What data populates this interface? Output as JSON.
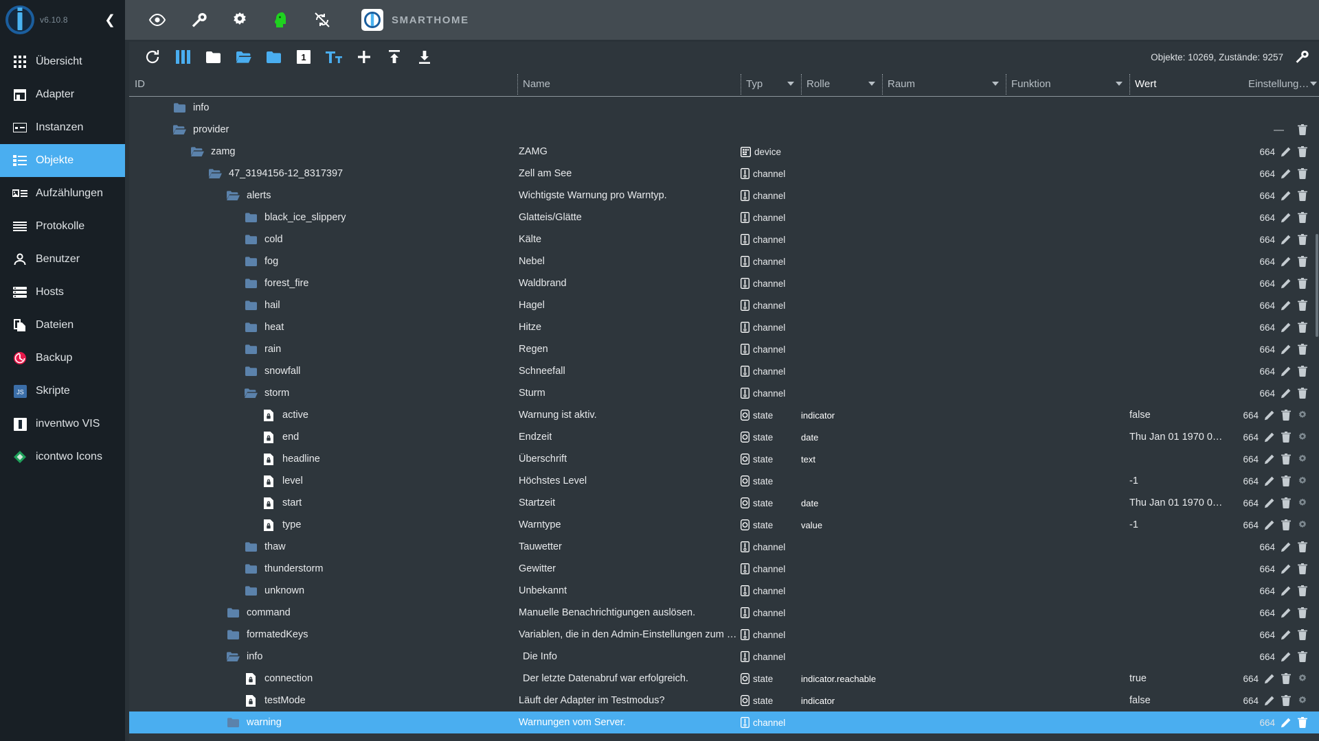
{
  "sidebar": {
    "version": "v6.10.8",
    "collapse_icon": "chevron-left-icon",
    "items": [
      {
        "label": "Übersicht",
        "icon": "grid-icon",
        "active": false
      },
      {
        "label": "Adapter",
        "icon": "shop-icon",
        "active": false
      },
      {
        "label": "Instanzen",
        "icon": "instances-icon",
        "active": false
      },
      {
        "label": "Objekte",
        "icon": "list-icon",
        "active": true
      },
      {
        "label": "Aufzählungen",
        "icon": "enums-icon",
        "active": false
      },
      {
        "label": "Protokolle",
        "icon": "lines-icon",
        "active": false
      },
      {
        "label": "Benutzer",
        "icon": "person-icon",
        "active": false
      },
      {
        "label": "Hosts",
        "icon": "hosts-icon",
        "active": false
      },
      {
        "label": "Dateien",
        "icon": "files-icon",
        "active": false
      },
      {
        "label": "Backup",
        "icon": "backup-clock-icon",
        "active": false
      },
      {
        "label": "Skripte",
        "icon": "js-icon",
        "active": false
      },
      {
        "label": "inventwo VIS",
        "icon": "inventwo-icon",
        "active": false
      },
      {
        "label": "icontwo Icons",
        "icon": "icontwo-icon",
        "active": false
      }
    ]
  },
  "topbar": {
    "icons": [
      "eye-icon",
      "wrench-icon",
      "gear-icon",
      "head-green-icon",
      "no-sync-icon"
    ],
    "host_label": "SMARTHOME",
    "host_logo_icon": "iobroker-logo-icon"
  },
  "objects_toolbar": {
    "buttons": [
      "refresh-icon",
      "columns-icon",
      "folder-closed-icon",
      "folder-open-icon",
      "folder-filled-icon",
      "expand-level-1-icon",
      "text-size-icon",
      "add-icon",
      "import-icon",
      "export-icon"
    ],
    "expand_level_label": "1",
    "stats": "Objekte: 10269, Zustände: 9257",
    "settings_icon": "wrench-icon"
  },
  "table": {
    "columns": [
      {
        "key": "id",
        "label": "ID",
        "sortable": false
      },
      {
        "key": "name",
        "label": "Name",
        "sortable": false
      },
      {
        "key": "typ",
        "label": "Typ",
        "sortable": true
      },
      {
        "key": "role",
        "label": "Rolle",
        "sortable": true
      },
      {
        "key": "room",
        "label": "Raum",
        "sortable": true
      },
      {
        "key": "func",
        "label": "Funktion",
        "sortable": true
      },
      {
        "key": "wert",
        "label": "Wert",
        "sortable": false
      },
      {
        "key": "set",
        "label": "Einstellung…",
        "sortable": true
      }
    ],
    "rows": [
      {
        "id": "info",
        "depth": 2,
        "icon": "folder-filled-icon",
        "name": "",
        "name_icon": "info-badge-icon",
        "typ": "",
        "typ_icon": "",
        "role": "",
        "wert": "",
        "perm": "",
        "actions": [],
        "selected": false,
        "partial": true
      },
      {
        "id": "provider",
        "depth": 2,
        "icon": "folder-open-icon",
        "name": "",
        "typ": "",
        "typ_icon": "",
        "role": "",
        "wert": "",
        "perm": "",
        "dash": true,
        "actions": [
          "delete-icon"
        ],
        "selected": false
      },
      {
        "id": "zamg",
        "depth": 3,
        "icon": "folder-open-icon",
        "name": "ZAMG",
        "typ": "device",
        "typ_icon": "device-icon",
        "role": "",
        "wert": "",
        "perm": "664",
        "actions": [
          "edit-icon",
          "delete-icon"
        ],
        "selected": false
      },
      {
        "id": "47_3194156-12_8317397",
        "depth": 4,
        "icon": "folder-open-icon",
        "name": "Zell am See",
        "typ": "channel",
        "typ_icon": "channel-icon",
        "role": "",
        "wert": "",
        "perm": "664",
        "actions": [
          "edit-icon",
          "delete-icon"
        ],
        "selected": false
      },
      {
        "id": "alerts",
        "depth": 5,
        "icon": "folder-open-icon",
        "name": "Wichtigste Warnung pro Warntyp.",
        "typ": "channel",
        "typ_icon": "channel-icon",
        "role": "",
        "wert": "",
        "perm": "664",
        "actions": [
          "edit-icon",
          "delete-icon"
        ],
        "selected": false
      },
      {
        "id": "black_ice_slippery",
        "depth": 6,
        "icon": "folder-filled-icon",
        "name": "Glatteis/Glätte",
        "typ": "channel",
        "typ_icon": "channel-icon",
        "role": "",
        "wert": "",
        "perm": "664",
        "actions": [
          "edit-icon",
          "delete-icon"
        ],
        "selected": false
      },
      {
        "id": "cold",
        "depth": 6,
        "icon": "folder-filled-icon",
        "name": "Kälte",
        "typ": "channel",
        "typ_icon": "channel-icon",
        "role": "",
        "wert": "",
        "perm": "664",
        "actions": [
          "edit-icon",
          "delete-icon"
        ],
        "selected": false
      },
      {
        "id": "fog",
        "depth": 6,
        "icon": "folder-filled-icon",
        "name": "Nebel",
        "typ": "channel",
        "typ_icon": "channel-icon",
        "role": "",
        "wert": "",
        "perm": "664",
        "actions": [
          "edit-icon",
          "delete-icon"
        ],
        "selected": false
      },
      {
        "id": "forest_fire",
        "depth": 6,
        "icon": "folder-filled-icon",
        "name": "Waldbrand",
        "typ": "channel",
        "typ_icon": "channel-icon",
        "role": "",
        "wert": "",
        "perm": "664",
        "actions": [
          "edit-icon",
          "delete-icon"
        ],
        "selected": false
      },
      {
        "id": "hail",
        "depth": 6,
        "icon": "folder-filled-icon",
        "name": "Hagel",
        "typ": "channel",
        "typ_icon": "channel-icon",
        "role": "",
        "wert": "",
        "perm": "664",
        "actions": [
          "edit-icon",
          "delete-icon"
        ],
        "selected": false
      },
      {
        "id": "heat",
        "depth": 6,
        "icon": "folder-filled-icon",
        "name": "Hitze",
        "typ": "channel",
        "typ_icon": "channel-icon",
        "role": "",
        "wert": "",
        "perm": "664",
        "actions": [
          "edit-icon",
          "delete-icon"
        ],
        "selected": false
      },
      {
        "id": "rain",
        "depth": 6,
        "icon": "folder-filled-icon",
        "name": "Regen",
        "typ": "channel",
        "typ_icon": "channel-icon",
        "role": "",
        "wert": "",
        "perm": "664",
        "actions": [
          "edit-icon",
          "delete-icon"
        ],
        "selected": false
      },
      {
        "id": "snowfall",
        "depth": 6,
        "icon": "folder-filled-icon",
        "name": "Schneefall",
        "typ": "channel",
        "typ_icon": "channel-icon",
        "role": "",
        "wert": "",
        "perm": "664",
        "actions": [
          "edit-icon",
          "delete-icon"
        ],
        "selected": false
      },
      {
        "id": "storm",
        "depth": 6,
        "icon": "folder-open-icon",
        "name": "Sturm",
        "typ": "channel",
        "typ_icon": "channel-icon",
        "role": "",
        "wert": "",
        "perm": "664",
        "actions": [
          "edit-icon",
          "delete-icon"
        ],
        "selected": false
      },
      {
        "id": "active",
        "depth": 7,
        "icon": "state-lock-icon",
        "name": "Warnung ist aktiv.",
        "typ": "state",
        "typ_icon": "state-icon",
        "role": "indicator",
        "wert": "false",
        "perm": "664",
        "actions": [
          "edit-icon",
          "delete-icon",
          "gear-icon"
        ],
        "selected": false
      },
      {
        "id": "end",
        "depth": 7,
        "icon": "state-lock-icon",
        "name": "Endzeit",
        "typ": "state",
        "typ_icon": "state-icon",
        "role": "date",
        "wert": "Thu Jan 01 1970 0…",
        "perm": "664",
        "actions": [
          "edit-icon",
          "delete-icon",
          "gear-icon"
        ],
        "selected": false
      },
      {
        "id": "headline",
        "depth": 7,
        "icon": "state-lock-icon",
        "name": "Überschrift",
        "typ": "state",
        "typ_icon": "state-icon",
        "role": "text",
        "wert": "",
        "perm": "664",
        "actions": [
          "edit-icon",
          "delete-icon",
          "gear-icon"
        ],
        "selected": false
      },
      {
        "id": "level",
        "depth": 7,
        "icon": "state-lock-icon",
        "name": "Höchstes Level",
        "typ": "state",
        "typ_icon": "state-icon",
        "role": "",
        "wert": "-1",
        "perm": "664",
        "actions": [
          "edit-icon",
          "delete-icon",
          "gear-icon"
        ],
        "selected": false
      },
      {
        "id": "start",
        "depth": 7,
        "icon": "state-lock-icon",
        "name": "Startzeit",
        "typ": "state",
        "typ_icon": "state-icon",
        "role": "date",
        "wert": "Thu Jan 01 1970 0…",
        "perm": "664",
        "actions": [
          "edit-icon",
          "delete-icon",
          "gear-icon"
        ],
        "selected": false
      },
      {
        "id": "type",
        "depth": 7,
        "icon": "state-lock-icon",
        "name": "Warntype",
        "typ": "state",
        "typ_icon": "state-icon",
        "role": "value",
        "wert": "-1",
        "perm": "664",
        "actions": [
          "edit-icon",
          "delete-icon",
          "gear-icon"
        ],
        "selected": false
      },
      {
        "id": "thaw",
        "depth": 6,
        "icon": "folder-filled-icon",
        "name": "Tauwetter",
        "typ": "channel",
        "typ_icon": "channel-icon",
        "role": "",
        "wert": "",
        "perm": "664",
        "actions": [
          "edit-icon",
          "delete-icon"
        ],
        "selected": false
      },
      {
        "id": "thunderstorm",
        "depth": 6,
        "icon": "folder-filled-icon",
        "name": "Gewitter",
        "typ": "channel",
        "typ_icon": "channel-icon",
        "role": "",
        "wert": "",
        "perm": "664",
        "actions": [
          "edit-icon",
          "delete-icon"
        ],
        "selected": false
      },
      {
        "id": "unknown",
        "depth": 6,
        "icon": "folder-filled-icon",
        "name": "Unbekannt",
        "typ": "channel",
        "typ_icon": "channel-icon",
        "role": "",
        "wert": "",
        "perm": "664",
        "actions": [
          "edit-icon",
          "delete-icon"
        ],
        "selected": false
      },
      {
        "id": "command",
        "depth": 5,
        "icon": "folder-filled-icon",
        "name": "Manuelle Benachrichtigungen auslösen.",
        "typ": "channel",
        "typ_icon": "channel-icon",
        "role": "",
        "wert": "",
        "perm": "664",
        "actions": [
          "edit-icon",
          "delete-icon"
        ],
        "selected": false
      },
      {
        "id": "formatedKeys",
        "depth": 5,
        "icon": "folder-filled-icon",
        "name": "Variablen, die in den Admin-Einstellungen zum Kon…",
        "typ": "channel",
        "typ_icon": "channel-icon",
        "role": "",
        "wert": "",
        "perm": "664",
        "actions": [
          "edit-icon",
          "delete-icon"
        ],
        "selected": false
      },
      {
        "id": "info",
        "depth": 5,
        "icon": "folder-open-icon",
        "name": "Die Info",
        "name_icon": "info-badge-icon",
        "typ": "channel",
        "typ_icon": "channel-icon",
        "role": "",
        "wert": "",
        "perm": "664",
        "actions": [
          "edit-icon",
          "delete-icon"
        ],
        "selected": false
      },
      {
        "id": "connection",
        "depth": 6,
        "icon": "state-lock-icon",
        "name": "Der letzte Datenabruf war erfolgreich.",
        "name_icon": "wifi-icon",
        "typ": "state",
        "typ_icon": "state-icon",
        "role": "indicator.reachable",
        "wert": "true",
        "perm": "664",
        "actions": [
          "edit-icon",
          "delete-icon",
          "gear-icon"
        ],
        "selected": false
      },
      {
        "id": "testMode",
        "depth": 6,
        "icon": "state-lock-icon",
        "name": "Läuft der Adapter im Testmodus?",
        "typ": "state",
        "typ_icon": "state-icon",
        "role": "indicator",
        "wert": "false",
        "perm": "664",
        "actions": [
          "edit-icon",
          "delete-icon",
          "gear-icon"
        ],
        "selected": false
      },
      {
        "id": "warning",
        "depth": 5,
        "icon": "folder-filled-icon",
        "name": "Warnungen vom Server.",
        "typ": "channel",
        "typ_icon": "channel-icon",
        "role": "",
        "wert": "",
        "perm": "664",
        "actions": [
          "edit-icon",
          "delete-icon"
        ],
        "selected": true
      }
    ]
  },
  "colors": {
    "accent": "#4aaef0",
    "sidebar_bg": "#181f25",
    "panel_bg": "#2e363c",
    "topbar_bg": "#434b51",
    "folder_blue": "#5b82ab",
    "role_text": "#ffffff"
  }
}
